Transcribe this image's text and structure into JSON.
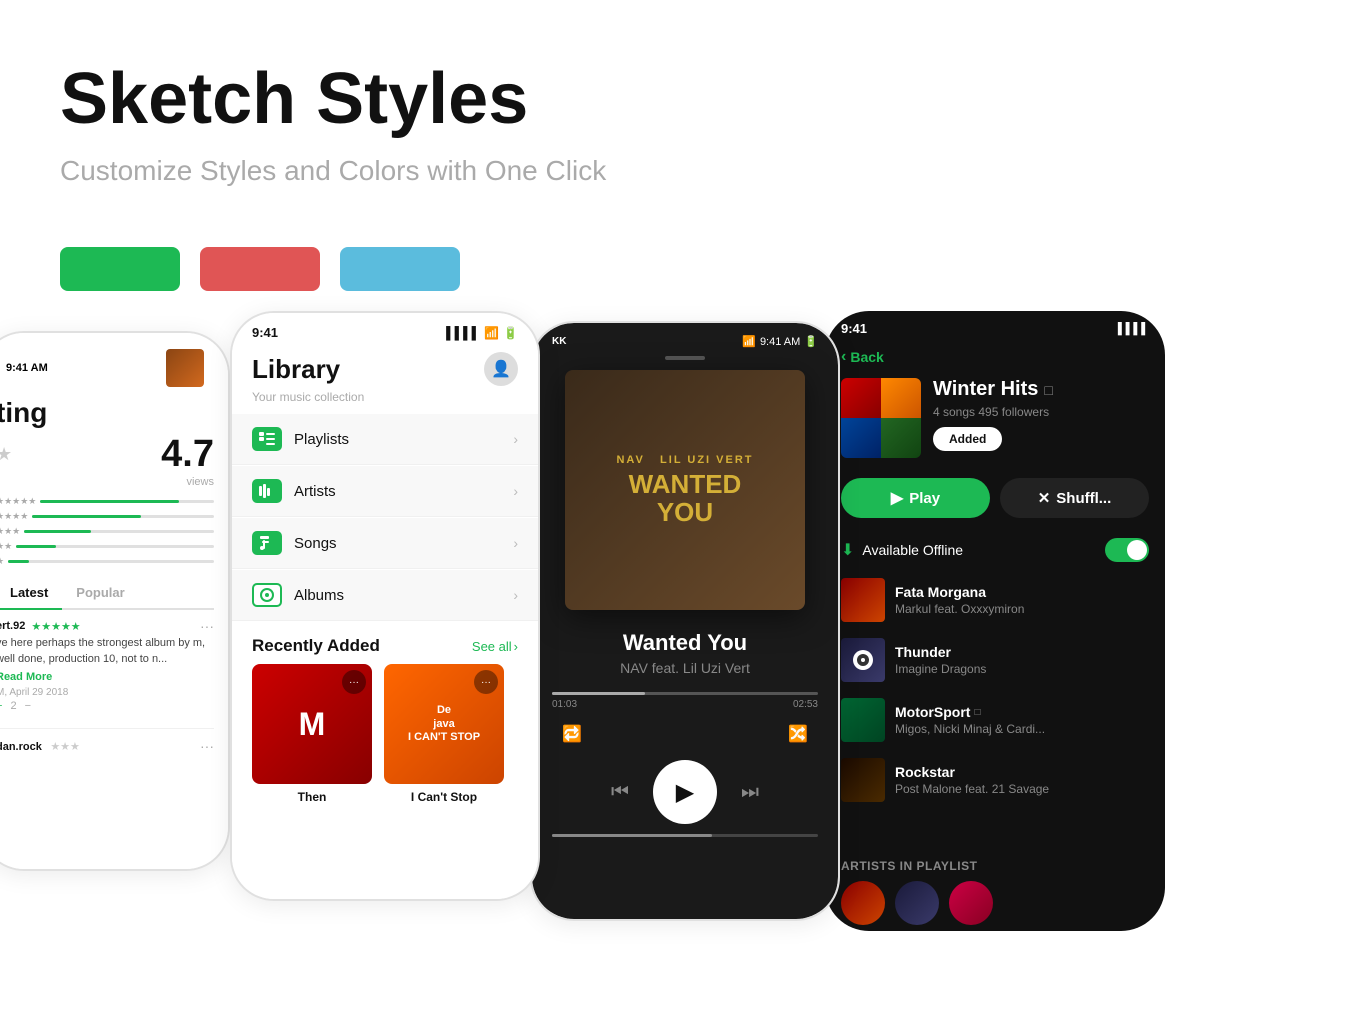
{
  "header": {
    "title": "Sketch Styles",
    "subtitle": "Customize Styles and Colors with One Click"
  },
  "swatches": [
    {
      "color": "#1db954",
      "label": "green"
    },
    {
      "color": "#e05555",
      "label": "red"
    },
    {
      "color": "#5bbcdd",
      "label": "blue"
    }
  ],
  "phone1": {
    "time": "9:41 AM",
    "title": "ting",
    "rating": "4.7",
    "reviews_label": "views",
    "bars": [
      80,
      60,
      40,
      25,
      10
    ],
    "tabs": [
      "Latest",
      "Popular"
    ],
    "active_tab": "Latest",
    "reviewer": "ert.92",
    "reviewer_stars": "★★★★★",
    "review_text": "ve here perhaps the strongest album by m, well done, production 10, not to n...",
    "read_more": "Read More",
    "review_date": "M, April 29 2018",
    "like_count": "2"
  },
  "phone2": {
    "time": "9:41",
    "signal": "▌▌▌▌",
    "wifi": "WiFi",
    "battery": "Battery",
    "title": "Library",
    "subtitle": "Your music collection",
    "menu_items": [
      {
        "icon": "≡",
        "label": "Playlists"
      },
      {
        "icon": "▐▐",
        "label": "Artists"
      },
      {
        "icon": "♪",
        "label": "Songs"
      },
      {
        "icon": "⊙",
        "label": "Albums"
      }
    ],
    "recently_added_label": "Recently Added",
    "see_all_label": "See all",
    "albums": [
      {
        "title": "Then"
      },
      {
        "title": "I Can't Stop"
      }
    ]
  },
  "phone3": {
    "time": "9:41 AM",
    "kk": "KK",
    "signal_dots": "...",
    "song_title": "Wanted You",
    "artist": "NAV feat. Lil Uzi Vert",
    "current_time": "01:03",
    "total_time": "02:53",
    "progress_pct": 35
  },
  "phone4": {
    "time": "9:41",
    "signal": "▌▌▌▌",
    "back_label": "Back",
    "playlist_title": "Winter Hits",
    "playlist_meta": "4 songs 495 followers",
    "added_label": "Added",
    "play_label": "Play",
    "shuffle_label": "Shuffl...",
    "offline_label": "Available Offline",
    "tracks": [
      {
        "title": "Fata Morgana",
        "artist": "Markul feat. Oxxxymiron",
        "art_class": "art-fata"
      },
      {
        "title": "Thunder",
        "artist": "Imagine Dragons",
        "art_class": "art-thunder"
      },
      {
        "title": "MotorSport",
        "artist": "Migos, Nicki Minaj & Cardi...",
        "art_class": "art-motor"
      },
      {
        "title": "Rockstar",
        "artist": "Post Malone feat. 21 Savage",
        "art_class": "art-rock"
      }
    ],
    "artists_label": "Artists in Playlist"
  }
}
